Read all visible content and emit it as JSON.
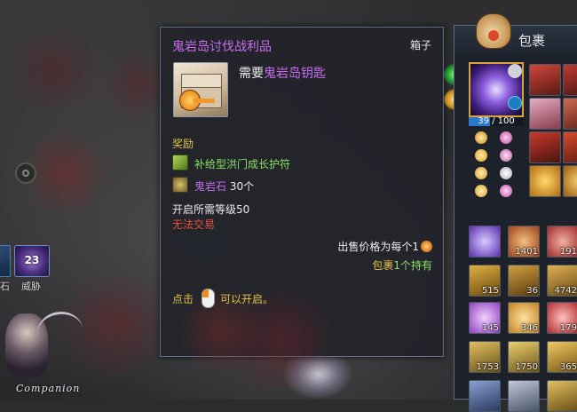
{
  "tooltip": {
    "title": "鬼岩岛讨伐战利品",
    "type": "箱子",
    "need_prefix": "需要",
    "need_item": "鬼岩岛钥匙",
    "reward_heading": "奖励",
    "rewards": [
      {
        "name": "补给型洪门成长护符",
        "count": ""
      },
      {
        "name": "鬼岩石",
        "count": "30个"
      }
    ],
    "level_req": "开启所需等级50",
    "trade": "无法交易",
    "price_text": "出售价格为每个1",
    "bag_prefix": "包裹",
    "bag_count": "1个持有",
    "click_prefix": "点击",
    "click_suffix": "可以开启。"
  },
  "inventory": {
    "title": "包裹",
    "capacity": "39 / 100",
    "capacity_fraction": 0.39,
    "slot_counts": [
      "1401",
      "191",
      "515",
      "36",
      "4742",
      "145",
      "346",
      "179",
      "1753",
      "1750",
      "365"
    ]
  },
  "hud": {
    "skill_level": "23",
    "skill_left_label": "石",
    "skill_right_label": "威胁",
    "companion_label": "Companion"
  },
  "colors": {
    "epic_purple": "#c86cf0",
    "reward_gold": "#e0c24a",
    "green": "#8ae066",
    "red": "#e5503c"
  }
}
